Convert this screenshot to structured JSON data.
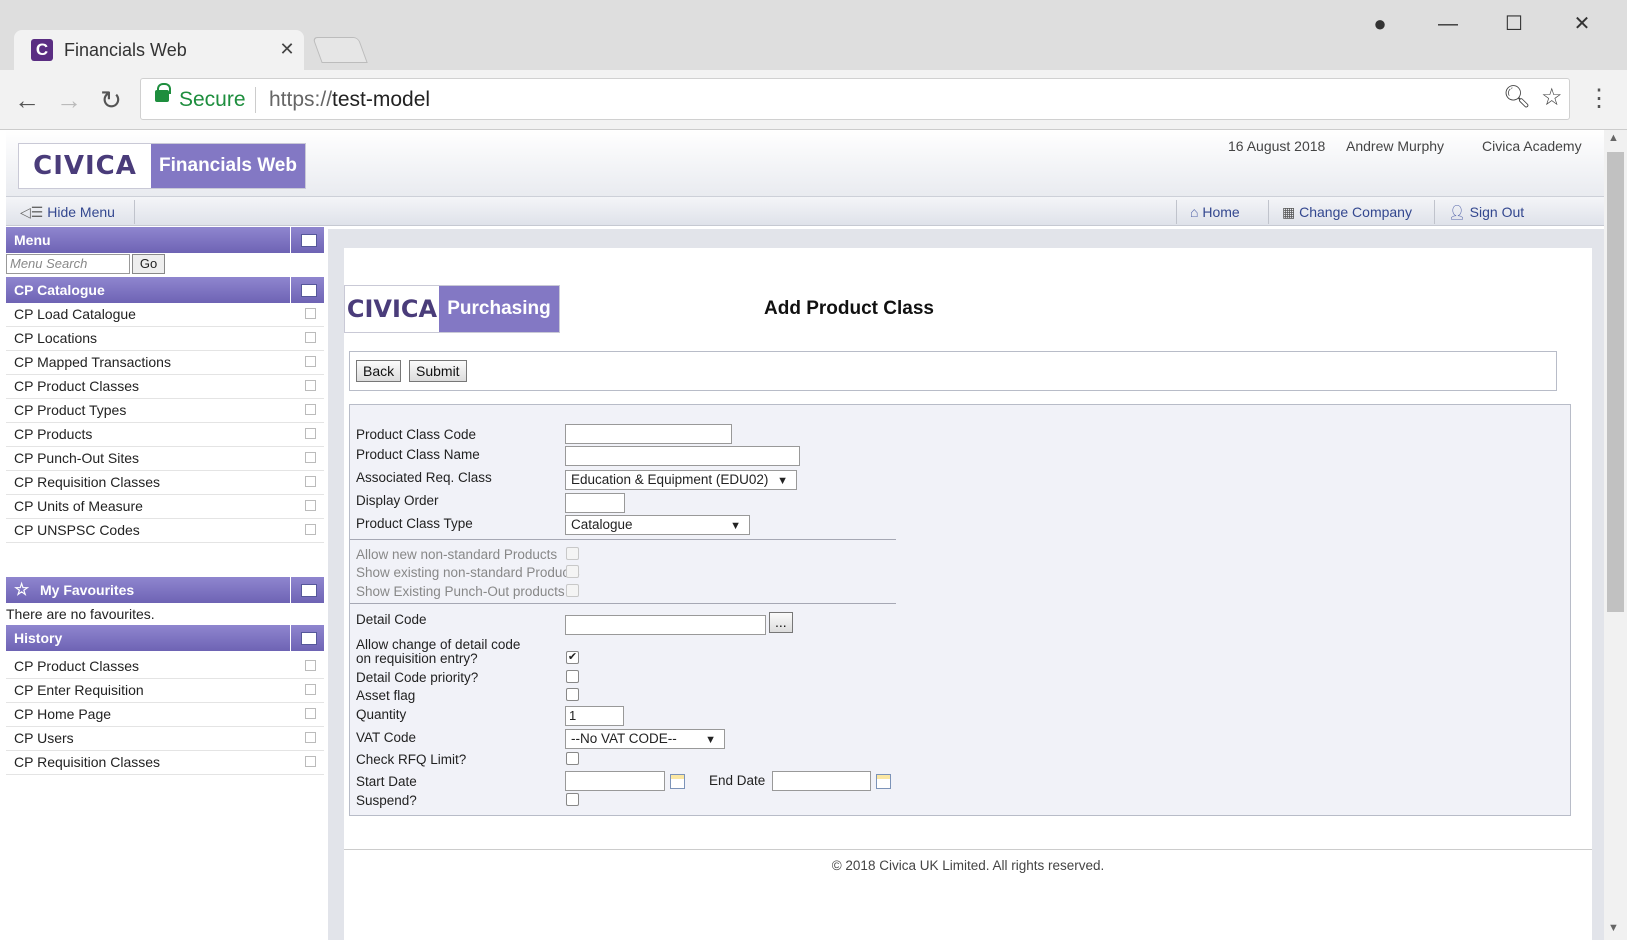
{
  "browser": {
    "tab_title": "Financials Web",
    "tab_icon_letter": "C",
    "secure_label": "Secure",
    "url_scheme": "https://",
    "url_host": "test-model"
  },
  "header": {
    "logo_brand": "CIVICA",
    "logo_product": "Financials Web",
    "date": "16 August 2018",
    "user": "Andrew Murphy",
    "company": "Civica Academy"
  },
  "navbar": {
    "hide_menu": "Hide Menu",
    "home": "Home",
    "change_company": "Change Company",
    "sign_out": "Sign Out"
  },
  "sidebar": {
    "menu_title": "Menu",
    "search_placeholder": "Menu Search",
    "go_label": "Go",
    "catalogue_title": "CP Catalogue",
    "catalogue_items": [
      "CP Load Catalogue",
      "CP Locations",
      "CP Mapped Transactions",
      "CP Product Classes",
      "CP Product Types",
      "CP Products",
      "CP Punch-Out Sites",
      "CP Requisition Classes",
      "CP Units of Measure",
      "CP UNSPSC Codes"
    ],
    "favourites_title": "My Favourites",
    "favourites_empty": "There are no favourites.",
    "history_title": "History",
    "history_items": [
      "CP Product Classes",
      "CP Enter Requisition",
      "CP Home Page",
      "CP Users",
      "CP Requisition Classes"
    ]
  },
  "content": {
    "logo_brand": "CIVICA",
    "logo_product": "Purchasing",
    "title": "Add Product Class",
    "back_label": "Back",
    "submit_label": "Submit"
  },
  "form": {
    "product_class_code_label": "Product Class Code",
    "product_class_code_value": "",
    "product_class_name_label": "Product Class Name",
    "product_class_name_value": "",
    "associated_req_class_label": "Associated Req. Class",
    "associated_req_class_value": "Education & Equipment (EDU02)",
    "display_order_label": "Display Order",
    "display_order_value": "",
    "product_class_type_label": "Product Class Type",
    "product_class_type_value": "Catalogue",
    "allow_new_label": "Allow new non-standard Products",
    "show_existing_label": "Show existing non-standard Products",
    "show_punchout_label": "Show Existing Punch-Out products",
    "detail_code_label": "Detail Code",
    "detail_code_value": "",
    "detail_code_lookup": "...",
    "allow_change_label_1": "Allow change of detail code",
    "allow_change_label_2": "on requisition entry?",
    "allow_change_checked": true,
    "detail_priority_label": "Detail Code priority?",
    "asset_flag_label": "Asset flag",
    "quantity_label": "Quantity",
    "quantity_value": "1",
    "vat_code_label": "VAT Code",
    "vat_code_value": "--No VAT CODE--",
    "check_rfq_label": "Check RFQ Limit?",
    "start_date_label": "Start Date",
    "start_date_value": "",
    "end_date_label": "End Date",
    "end_date_value": "",
    "suspend_label": "Suspend?"
  },
  "footer": {
    "copyright": "© 2018 Civica UK Limited. All rights reserved."
  }
}
